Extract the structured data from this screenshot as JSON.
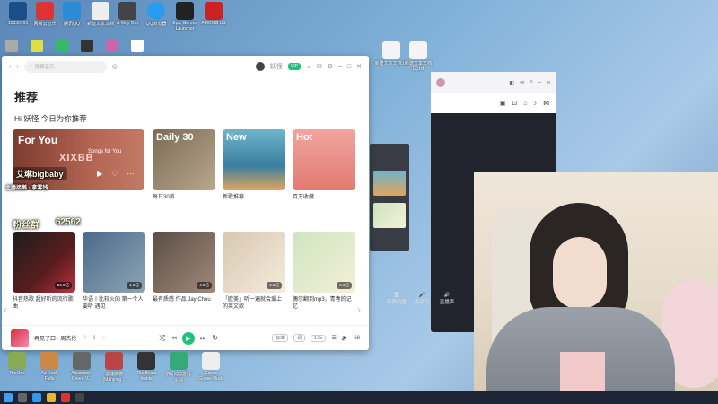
{
  "desktop": {
    "icons": [
      {
        "label": "网易云音乐",
        "color": "#d33"
      },
      {
        "label": "腾讯QQ",
        "color": "#2a8bd8"
      },
      {
        "label": "新建文本文档",
        "color": "#eee"
      },
      {
        "label": "A Way Out",
        "color": "#444"
      },
      {
        "label": "QQ浏览器",
        "color": "#2a9cf0"
      },
      {
        "label": "Epic Games Launcher",
        "color": "#222"
      },
      {
        "label": "AMONG US",
        "color": "#c22"
      }
    ],
    "bottom_icons": [
      {
        "label": "TheOne",
        "color": "#8a5"
      },
      {
        "label": "Ao Duck Falls",
        "color": "#c84"
      },
      {
        "label": "Assassin's Creed V...",
        "color": "#666"
      },
      {
        "label": "雀魂麻将 (Mahjong...",
        "color": "#b44"
      },
      {
        "label": "The Beast Inside",
        "color": "#333"
      },
      {
        "label": "腾讯QQ游戏 宗网",
        "color": "#3a7"
      },
      {
        "label": "Goose Goose Duck",
        "color": "#eee"
      }
    ],
    "top_label": "10830765",
    "file_labels": [
      "新建文本文档.txt",
      "新建文本文档 (2).txt"
    ]
  },
  "app": {
    "search_placeholder": "搜索音乐",
    "username": "妖怪",
    "vip_label": "VIP",
    "page_title": "推荐",
    "greeting": "Hi 妖怪 今日为你推荐",
    "featured": {
      "big": "For You",
      "sub": "Songs for You",
      "tag": "XIXBB"
    },
    "row1": [
      {
        "big": "Daily 30",
        "title": "每日30首",
        "bg": "linear-gradient(135deg,#7a6a57,#b9a88c)"
      },
      {
        "big": "New",
        "title": "新歌推荐",
        "bg": "linear-gradient(180deg,#6fb4c9,#3a7fa1 60%,#e0a55d)"
      },
      {
        "big": "Hot",
        "title": "百万收藏",
        "bg": "linear-gradient(180deg,#f2a4a0,#e27a72)"
      }
    ],
    "row2": [
      {
        "title": "抖音热歌 超好听的流行歌曲",
        "plays": "56.9亿",
        "bg": "linear-gradient(135deg,#1d1d1d,#5a1d1d 60%,#b34)"
      },
      {
        "title": "华语丨比较火的 第一个人要听 遇见",
        "plays": "1.9亿",
        "bg": "linear-gradient(135deg,#4a6a8a,#8fa5b5)"
      },
      {
        "title": "最有质感 作品 Jay Chou",
        "plays": "4.5亿",
        "bg": "linear-gradient(135deg,#5a4d45,#a08a7a)"
      },
      {
        "title": "「欧美」听一遍就会爱上的英文歌",
        "plays": "2.3亿",
        "bg": "linear-gradient(135deg,#d8c7b0,#f4ecdc)"
      },
      {
        "title": "偶尔翻到mp3，青春的记忆",
        "plays": "9.3亿",
        "bg": "linear-gradient(135deg,#cfe4c0,#f4f0d8)"
      }
    ],
    "player": {
      "song": "再见了口 · 周杰伦",
      "quality": "标准",
      "lyric": "词",
      "speed": "1.0x",
      "volume": "68"
    }
  },
  "overlay": {
    "name": "艾琳bigbaby",
    "fans": "粉丝群",
    "id": "62562",
    "line": "主播接鹅 · 拿零钱"
  },
  "dark_window": {
    "tools": [
      "摄像头",
      "麦克风",
      "直播声"
    ],
    "bottom": [
      "画面设置",
      "PK连线",
      "开播设置"
    ]
  }
}
